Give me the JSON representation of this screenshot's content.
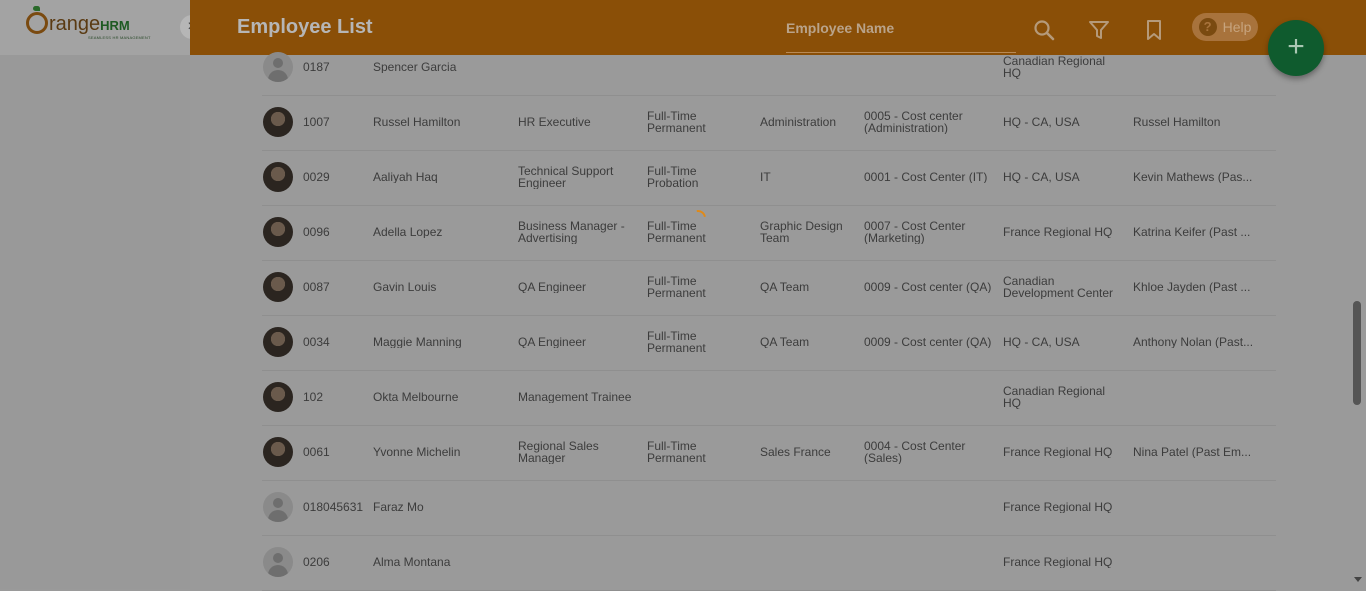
{
  "header": {
    "title": "Employee List",
    "search_placeholder": "Employee Name",
    "help_label": "Help"
  },
  "sidebar": {
    "logo_text_1": "range",
    "logo_text_2": "HRM",
    "logo_tagline": "SEAMLESS HR MANAGEMENT",
    "close_label": "×"
  },
  "fab_label": "+",
  "icons": {
    "search": "search-icon",
    "filter": "filter-icon",
    "bookmark": "bookmark-icon",
    "help": "help-icon",
    "add": "plus-icon",
    "close": "close-icon",
    "spinner": "loading-spinner-icon"
  },
  "colors": {
    "header": "#8a4f07",
    "fab": "#0f5b2e",
    "overlay_background": "#9a9a9a"
  },
  "employees": [
    {
      "id": "0187",
      "name": "Spencer Garcia",
      "job_title": "",
      "employment_status": "",
      "sub_unit": "",
      "cost_center": "",
      "location": "Canadian Regional HQ",
      "supervisor": "",
      "avatar": "blank"
    },
    {
      "id": "1007",
      "name": "Russel Hamilton",
      "job_title": "HR Executive",
      "employment_status": "Full-Time Permanent",
      "sub_unit": "Administration",
      "cost_center": "0005 - Cost center (Administration)",
      "location": "HQ - CA, USA",
      "supervisor": "Russel Hamilton",
      "avatar": "photo"
    },
    {
      "id": "0029",
      "name": "Aaliyah Haq",
      "job_title": "Technical Support Engineer",
      "employment_status": "Full-Time Probation",
      "sub_unit": "IT",
      "cost_center": "0001 - Cost Center (IT)",
      "location": "HQ - CA, USA",
      "supervisor": "Kevin Mathews (Pas...",
      "avatar": "photo"
    },
    {
      "id": "0096",
      "name": "Adella Lopez",
      "job_title": "Business Manager - Advertising",
      "employment_status": "Full-Time Permanent",
      "sub_unit": "Graphic Design Team",
      "cost_center": "0007 - Cost Center (Marketing)",
      "location": "France Regional HQ",
      "supervisor": "Katrina Keifer (Past ...",
      "avatar": "photo"
    },
    {
      "id": "0087",
      "name": "Gavin Louis",
      "job_title": "QA Engineer",
      "employment_status": "Full-Time Permanent",
      "sub_unit": "QA Team",
      "cost_center": "0009 - Cost center (QA)",
      "location": "Canadian Development Center",
      "supervisor": "Khloe Jayden (Past ...",
      "avatar": "photo"
    },
    {
      "id": "0034",
      "name": "Maggie Manning",
      "job_title": "QA Engineer",
      "employment_status": "Full-Time Permanent",
      "sub_unit": "QA Team",
      "cost_center": "0009 - Cost center (QA)",
      "location": "HQ - CA, USA",
      "supervisor": "Anthony Nolan (Past...",
      "avatar": "photo"
    },
    {
      "id": "102",
      "name": "Okta Melbourne",
      "job_title": "Management Trainee",
      "employment_status": "",
      "sub_unit": "",
      "cost_center": "",
      "location": "Canadian Regional HQ",
      "supervisor": "",
      "avatar": "photo"
    },
    {
      "id": "0061",
      "name": "Yvonne Michelin",
      "job_title": "Regional Sales Manager",
      "employment_status": "Full-Time Permanent",
      "sub_unit": "Sales France",
      "cost_center": "0004 - Cost Center (Sales)",
      "location": "France Regional HQ",
      "supervisor": "Nina Patel (Past Em...",
      "avatar": "photo"
    },
    {
      "id": "018045631",
      "name": "Faraz Mo",
      "job_title": "",
      "employment_status": "",
      "sub_unit": "",
      "cost_center": "",
      "location": "France Regional HQ",
      "supervisor": "",
      "avatar": "blank"
    },
    {
      "id": "0206",
      "name": "Alma Montana",
      "job_title": "",
      "employment_status": "",
      "sub_unit": "",
      "cost_center": "",
      "location": "France Regional HQ",
      "supervisor": "",
      "avatar": "blank"
    }
  ]
}
